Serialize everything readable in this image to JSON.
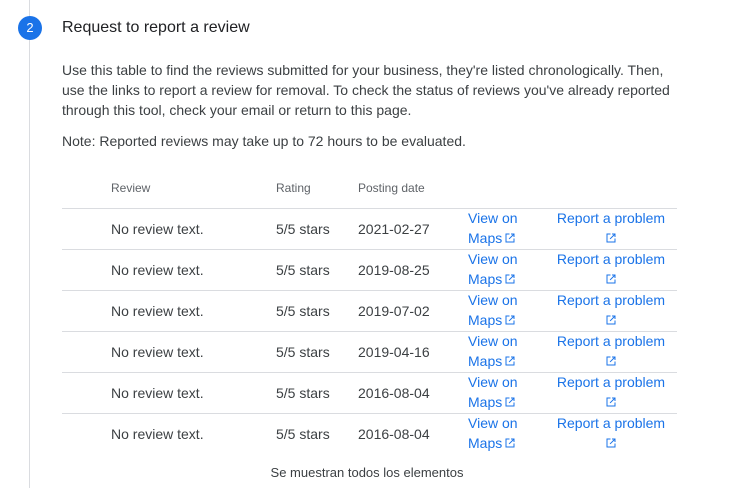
{
  "step": {
    "number": "2",
    "title": "Request to report a review"
  },
  "intro_text": "Use this table to find the reviews submitted for your business, they're listed chronologically. Then, use the links to report a review for removal. To check the status of reviews you've already reported through this tool, check your email or return to this page.",
  "note_text": "Note: Reported reviews may take up to 72 hours to be evaluated.",
  "table": {
    "headers": {
      "review": "Review",
      "rating": "Rating",
      "date": "Posting date"
    },
    "rows": [
      {
        "review": "No review text.",
        "rating": "5/5 stars",
        "date": "2021-02-27",
        "maps_line1": "View on",
        "maps_line2": "Maps",
        "report": "Report a problem"
      },
      {
        "review": "No review text.",
        "rating": "5/5 stars",
        "date": "2019-08-25",
        "maps_line1": "View on",
        "maps_line2": "Maps",
        "report": "Report a problem"
      },
      {
        "review": "No review text.",
        "rating": "5/5 stars",
        "date": "2019-07-02",
        "maps_line1": "View on",
        "maps_line2": "Maps",
        "report": "Report a problem"
      },
      {
        "review": "No review text.",
        "rating": "5/5 stars",
        "date": "2019-04-16",
        "maps_line1": "View on",
        "maps_line2": "Maps",
        "report": "Report a problem"
      },
      {
        "review": "No review text.",
        "rating": "5/5 stars",
        "date": "2016-08-04",
        "maps_line1": "View on",
        "maps_line2": "Maps",
        "report": "Report a problem"
      },
      {
        "review": "No review text.",
        "rating": "5/5 stars",
        "date": "2016-08-04",
        "maps_line1": "View on",
        "maps_line2": "Maps",
        "report": "Report a problem"
      }
    ]
  },
  "footer_text": "Se muestran todos los elementos",
  "icons": {
    "external_link": "open-in-new-icon"
  },
  "colors": {
    "accent": "#1a73e8",
    "text": "#3c4043",
    "divider": "#dadce0"
  }
}
